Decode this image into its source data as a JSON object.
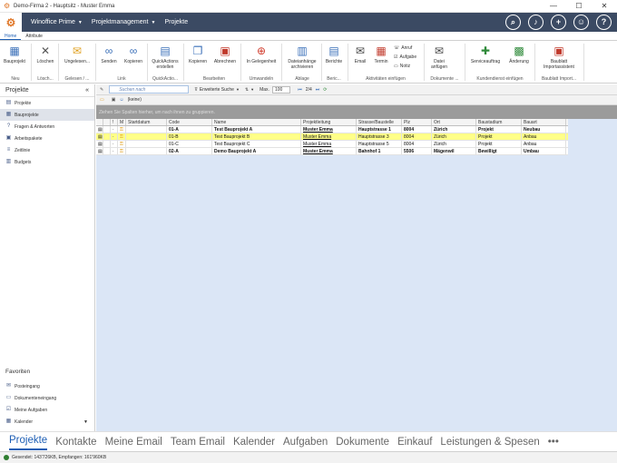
{
  "titlebar": {
    "title": "Demo-Firma 2 - Hauptsitz - Muster Emma",
    "min": "—",
    "max": "☐",
    "close": "✕"
  },
  "appbar": {
    "app_name": "Winoffice Prime",
    "module": "Projektmanagement",
    "page": "Projekte"
  },
  "ribbon_tabs": [
    "Home",
    "Attribute"
  ],
  "ribbon": {
    "buttons": [
      {
        "label": "Bauprojekt",
        "icon": "building-icon"
      },
      {
        "label": "Löschen",
        "icon": "delete-icon"
      },
      {
        "label": "Ungelesen...",
        "icon": "envelope-icon"
      },
      {
        "label": "Senden",
        "icon": "link-icon"
      },
      {
        "label": "Kopieren",
        "icon": "link-copy-icon"
      },
      {
        "label": "QuickActions erstellen",
        "icon": "clipboard-icon"
      },
      {
        "label": "Kopieren",
        "icon": "copy-icon"
      },
      {
        "label": "Abrechnen",
        "icon": "invoice-icon"
      },
      {
        "label": "In Gelegenheit",
        "icon": "target-icon"
      },
      {
        "label": "Dateianhänge archivieren",
        "icon": "archive-icon"
      },
      {
        "label": "Berichte",
        "icon": "report-icon"
      },
      {
        "label": "Email",
        "icon": "email-icon"
      },
      {
        "label": "Termin",
        "icon": "calendar-icon"
      },
      {
        "label": "Datei anfügen",
        "icon": "attach-icon"
      },
      {
        "label": "Serviceauftrag",
        "icon": "service-icon"
      },
      {
        "label": "Änderung",
        "icon": "change-icon"
      },
      {
        "label": "Baublatt Importassistent",
        "icon": "import-icon"
      }
    ],
    "small_buttons": [
      "Anruf",
      "Aufgabe",
      "Notiz"
    ],
    "groups": [
      "Neu",
      "Lösch...",
      "Gelesen / ...",
      "Link",
      "QuickActio...",
      "Bearbeiten",
      "Umwandeln",
      "Ablage",
      "Beric...",
      "Aktivitäten einfügen",
      "Dokumente ...",
      "Kundendienst einfügen",
      "Baublatt Import..."
    ]
  },
  "sidebar": {
    "title": "Projekte",
    "collapse": "«",
    "items": [
      "Projekte",
      "Bauprojekte",
      "Fragen & Antworten",
      "Arbeitspakete",
      "Zeitlinie",
      "Budgets"
    ],
    "selected_index": 1,
    "favorites_title": "Favoriten",
    "favorites": [
      "Posteingang",
      "Dokumenteneingang",
      "Meine Aufgaben",
      "Kalender"
    ]
  },
  "toolbar": {
    "search_placeholder": "Suchen nach",
    "extended_search": "Erweiterte Suche",
    "max_label": "Max.",
    "max_value": "100",
    "page_info": "2/4",
    "filter_label": "(keine)"
  },
  "groupbar_hint": "Ziehen Sie Spalten hierher, um nach ihnen zu gruppieren.",
  "grid": {
    "columns": [
      "",
      "",
      "!",
      "M",
      "Startdatum",
      "Code",
      "Name",
      "Projektleitung",
      "Strasse/Baustelle",
      "Plz",
      "Ort",
      "Baustadium",
      "Bauart"
    ],
    "rows": [
      {
        "code": "01-A",
        "name": "Test Bauprojekt A",
        "lead": "Muster Emma",
        "street": "Hauptstrasse 1",
        "plz": "8004",
        "ort": "Zürich",
        "stadium": "Projekt",
        "bauart": "Neubau",
        "bold": true
      },
      {
        "code": "01-B",
        "name": "Test Bauprojekt B",
        "lead": "Muster Emma",
        "street": "Hauptstrasse 3",
        "plz": "8004",
        "ort": "Zürich",
        "stadium": "Projekt",
        "bauart": "Anbau",
        "bold": false
      },
      {
        "code": "01-C",
        "name": "Test Bauprojekt C",
        "lead": "Muster Emma",
        "street": "Hauptstrasse 5",
        "plz": "8004",
        "ort": "Zürich",
        "stadium": "Projekt",
        "bauart": "Anbau",
        "bold": false
      },
      {
        "code": "02-A",
        "name": "Demo Bauprojekt A",
        "lead": "Muster Emma",
        "street": "Bahnhof 1",
        "plz": "5506",
        "ort": "Mägenwil",
        "stadium": "Bewilligt",
        "bauart": "Umbau",
        "bold": true
      }
    ],
    "selected_row": 1
  },
  "bottom_nav": [
    "Projekte",
    "Kontakte",
    "Meine Email",
    "Team Email",
    "Kalender",
    "Aufgaben",
    "Dokumente",
    "Einkauf",
    "Leistungen & Spesen",
    "•••"
  ],
  "status": {
    "text": "Gesendet: 143'726KB, Empfangen: 161'960KB"
  }
}
